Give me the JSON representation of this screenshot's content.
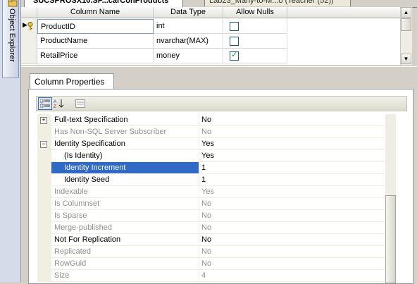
{
  "sidebar": {
    "object_explorer_label": "Object Explorer"
  },
  "tabs": {
    "active_label": "SUCSPROSX10.SP...carConProducts",
    "inactive_label": "Lab23_Many-to-M...o (Teacher (52))",
    "close_glyph": "×"
  },
  "grid": {
    "headers": [
      "Column Name",
      "Data Type",
      "Allow Nulls"
    ],
    "rows": [
      {
        "name": "ProductID",
        "type": "int",
        "allow_nulls": false,
        "current": true,
        "primary_key": true
      },
      {
        "name": "ProductName",
        "type": "nvarchar(MAX)",
        "allow_nulls": false
      },
      {
        "name": "RetailPrice",
        "type": "money",
        "allow_nulls": true
      }
    ],
    "check_glyph": "✓",
    "current_row_glyph": "▶"
  },
  "properties": {
    "tab_label": "Column Properties",
    "rows": [
      {
        "name": "Full-text Specification",
        "value": "No",
        "expander": "+",
        "enabled": true
      },
      {
        "name": "Has Non-SQL Server Subscriber",
        "value": "No",
        "enabled": false
      },
      {
        "name": "Identity Specification",
        "value": "Yes",
        "expander": "−",
        "enabled": true
      },
      {
        "name": "(Is Identity)",
        "value": "Yes",
        "enabled": true,
        "indent": true
      },
      {
        "name": "Identity Increment",
        "value": "1",
        "enabled": true,
        "indent": true,
        "selected": true
      },
      {
        "name": "Identity Seed",
        "value": "1",
        "enabled": true,
        "indent": true
      },
      {
        "name": "Indexable",
        "value": "Yes",
        "enabled": false
      },
      {
        "name": "Is Columnset",
        "value": "No",
        "enabled": false
      },
      {
        "name": "Is Sparse",
        "value": "No",
        "enabled": false
      },
      {
        "name": "Merge-published",
        "value": "No",
        "enabled": false
      },
      {
        "name": "Not For Replication",
        "value": "No",
        "enabled": true
      },
      {
        "name": "Replicated",
        "value": "No",
        "enabled": false
      },
      {
        "name": "RowGuid",
        "value": "No",
        "enabled": false
      },
      {
        "name": "Size",
        "value": "4",
        "enabled": false
      }
    ]
  },
  "colors": {
    "selection": "#316ac5",
    "disabled_text": "#8f8f8f"
  }
}
